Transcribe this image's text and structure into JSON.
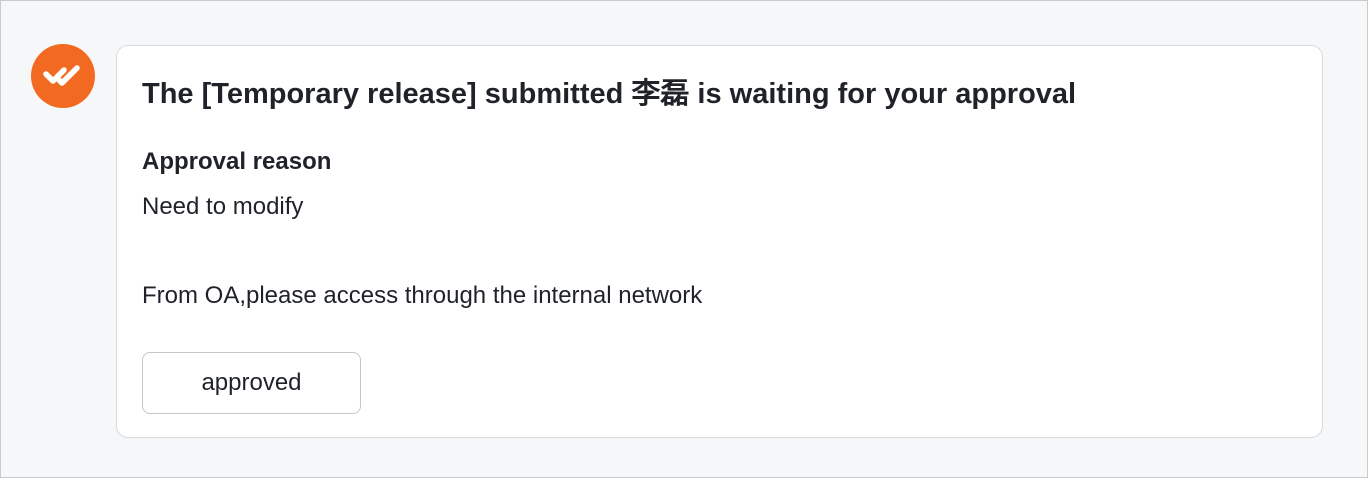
{
  "message": {
    "avatar_icon": "app-check-logo-icon",
    "accent_color": "#f26a21",
    "title": "The [Temporary release] submitted 李磊 is waiting for your approval",
    "reason_label": "Approval reason",
    "reason_value": "Need to modify",
    "source_note": "From OA,please access through the internal network",
    "action_button_label": "approved"
  }
}
